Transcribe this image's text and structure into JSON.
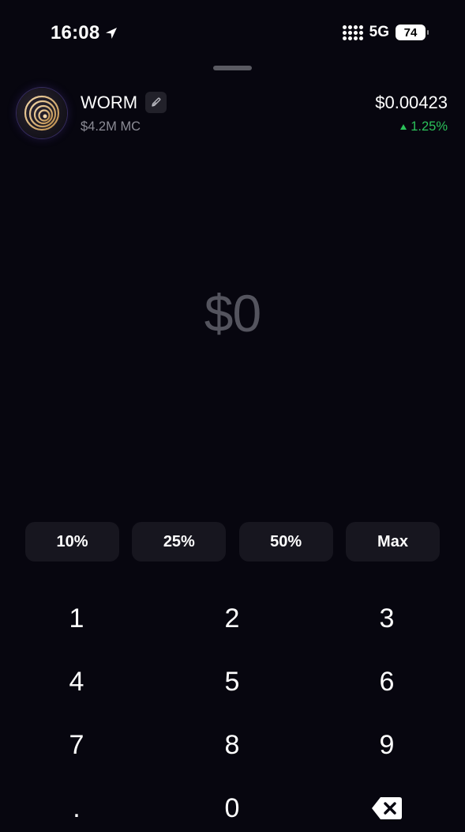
{
  "status_bar": {
    "time": "16:08",
    "network": "5G",
    "battery": "74"
  },
  "token": {
    "name": "WORM",
    "market_cap": "$4.2M MC",
    "price": "$0.00423",
    "change": "1.25%",
    "change_direction": "up",
    "change_color": "#2bc25a",
    "avatar_icon": "spiral-logo-icon",
    "edit_icon": "pencil-icon"
  },
  "amount": {
    "value": "$0"
  },
  "quick_amounts": [
    {
      "label": "10%"
    },
    {
      "label": "25%"
    },
    {
      "label": "50%"
    },
    {
      "label": "Max"
    }
  ],
  "keypad": {
    "keys": [
      "1",
      "2",
      "3",
      "4",
      "5",
      "6",
      "7",
      "8",
      "9",
      ".",
      "0"
    ],
    "backspace_icon": "backspace-icon"
  },
  "colors": {
    "background": "#07060f",
    "button_bg": "#17161f",
    "positive": "#2bc25a",
    "muted_text": "#8c8c96",
    "amount_placeholder": "#54545e"
  }
}
